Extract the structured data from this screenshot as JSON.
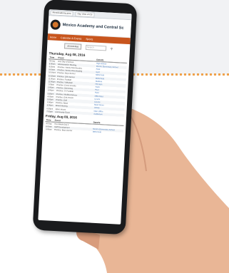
{
  "browser": {
    "tabs": [
      "MoreAcademy.aero",
      "Day View of CS"
    ]
  },
  "site": {
    "title": "Mexico Academy and Central Sc",
    "nav": [
      "Home",
      "Calendar & Events",
      "Sports"
    ]
  },
  "toolbar": {
    "button": "All Activities",
    "search_placeholder": "Search"
  },
  "table_headers": {
    "time": "Time",
    "event": "Event",
    "location": "Details"
  },
  "days": [
    {
      "title": "Thursday, Aug 08, 2016",
      "rows": [
        {
          "time": "All Day",
          "event": "First Day of School",
          "location": "High School"
        },
        {
          "time": "8:00am",
          "event": "Administrative Meeting",
          "location": "Mexico Elementary School"
        },
        {
          "time": "8:30am",
          "event": "Practice: Varsity Field Hockey",
          "location": "Field"
        },
        {
          "time": "9:00am",
          "event": "Practice: Varsity Cheerleading",
          "location": "Gym"
        },
        {
          "time": "10:00am",
          "event": "Practice: Boys Soccer",
          "location": "MES Field"
        },
        {
          "time": "10:30am",
          "event": "Practice: Girls Soccer",
          "location": "MHS Field"
        },
        {
          "time": "11:00am",
          "event": "Practice: Football",
          "location": "Stadium"
        },
        {
          "time": "12:00pm",
          "event": "Practice: Volleyball",
          "location": "HS Gym"
        },
        {
          "time": "1:00pm",
          "event": "Practice: Cross Country",
          "location": "Track"
        },
        {
          "time": "2:00pm",
          "event": "Practice: Swimming",
          "location": "Pool"
        },
        {
          "time": "3:00pm",
          "event": "Practice: JV Football",
          "location": "Field"
        },
        {
          "time": "3:30pm",
          "event": "Practice: Modified Soccer",
          "location": "MES Field"
        },
        {
          "time": "4:00pm",
          "event": "Practice: Girls Tennis",
          "location": "Courts"
        },
        {
          "time": "5:00pm",
          "event": "Practice: Golf",
          "location": "Course"
        },
        {
          "time": "5:30pm",
          "event": "Practice: Band",
          "location": "Band Room"
        },
        {
          "time": "6:00pm",
          "event": "Board Meeting",
          "location": "Library"
        },
        {
          "time": "6:30pm",
          "event": "Open House",
          "location": "Main Office"
        },
        {
          "time": "7:00pm",
          "event": "Community Event",
          "location": "Auditorium"
        }
      ]
    },
    {
      "title": "Friday, Aug 09, 2016",
      "rows": [
        {
          "time": "All Day",
          "event": "First Week Day 2",
          "location": ""
        },
        {
          "time": "8:00am",
          "event": "Staff Development",
          "location": "Mexico Elementary School"
        },
        {
          "time": "9:00am",
          "event": "Practice: Boys Soccer",
          "location": "MES Field"
        }
      ]
    }
  ]
}
